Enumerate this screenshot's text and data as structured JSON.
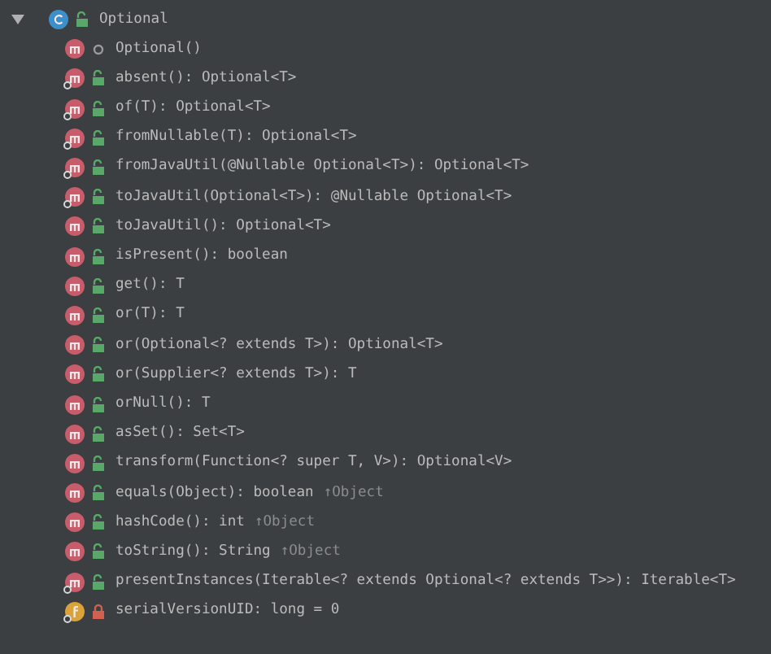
{
  "root": {
    "label": "Optional",
    "kind": "class",
    "access_icon": {
      "kind": "public"
    },
    "expanded": true,
    "children": [
      {
        "label": "Optional()",
        "kind": "method",
        "static": false,
        "access_icon": {
          "kind": "package"
        }
      },
      {
        "label": "absent(): Optional<T>",
        "kind": "method",
        "static": true,
        "access_icon": {
          "kind": "public"
        }
      },
      {
        "label": "of(T): Optional<T>",
        "kind": "method",
        "static": true,
        "access_icon": {
          "kind": "public"
        }
      },
      {
        "label": "fromNullable(T): Optional<T>",
        "kind": "method",
        "static": true,
        "access_icon": {
          "kind": "public"
        }
      },
      {
        "label": "fromJavaUtil(@Nullable Optional<T>): Optional<T>",
        "kind": "method",
        "static": true,
        "access_icon": {
          "kind": "public"
        }
      },
      {
        "label": "toJavaUtil(Optional<T>): @Nullable Optional<T>",
        "kind": "method",
        "static": true,
        "access_icon": {
          "kind": "public"
        }
      },
      {
        "label": "toJavaUtil(): Optional<T>",
        "kind": "method",
        "static": false,
        "access_icon": {
          "kind": "public"
        }
      },
      {
        "label": "isPresent(): boolean",
        "kind": "method",
        "static": false,
        "access_icon": {
          "kind": "public"
        }
      },
      {
        "label": "get(): T",
        "kind": "method",
        "static": false,
        "access_icon": {
          "kind": "public"
        }
      },
      {
        "label": "or(T): T",
        "kind": "method",
        "static": false,
        "access_icon": {
          "kind": "public"
        }
      },
      {
        "label": "or(Optional<? extends T>): Optional<T>",
        "kind": "method",
        "static": false,
        "access_icon": {
          "kind": "public"
        }
      },
      {
        "label": "or(Supplier<? extends T>): T",
        "kind": "method",
        "static": false,
        "access_icon": {
          "kind": "public"
        }
      },
      {
        "label": "orNull(): T",
        "kind": "method",
        "static": false,
        "access_icon": {
          "kind": "public"
        }
      },
      {
        "label": "asSet(): Set<T>",
        "kind": "method",
        "static": false,
        "access_icon": {
          "kind": "public"
        }
      },
      {
        "label": "transform(Function<? super T, V>): Optional<V>",
        "kind": "method",
        "static": false,
        "access_icon": {
          "kind": "public"
        }
      },
      {
        "label": "equals(Object): boolean",
        "kind": "method",
        "static": false,
        "access_icon": {
          "kind": "public"
        },
        "inherited": "↑Object"
      },
      {
        "label": "hashCode(): int",
        "kind": "method",
        "static": false,
        "access_icon": {
          "kind": "public"
        },
        "inherited": "↑Object"
      },
      {
        "label": "toString(): String",
        "kind": "method",
        "static": false,
        "access_icon": {
          "kind": "public"
        },
        "inherited": "↑Object"
      },
      {
        "label": "presentInstances(Iterable<? extends Optional<? extends T>>): Iterable<T>",
        "kind": "method",
        "static": true,
        "access_icon": {
          "kind": "public"
        }
      },
      {
        "label": "serialVersionUID: long = 0",
        "kind": "field",
        "static": true,
        "access_icon": {
          "kind": "private"
        }
      }
    ]
  }
}
